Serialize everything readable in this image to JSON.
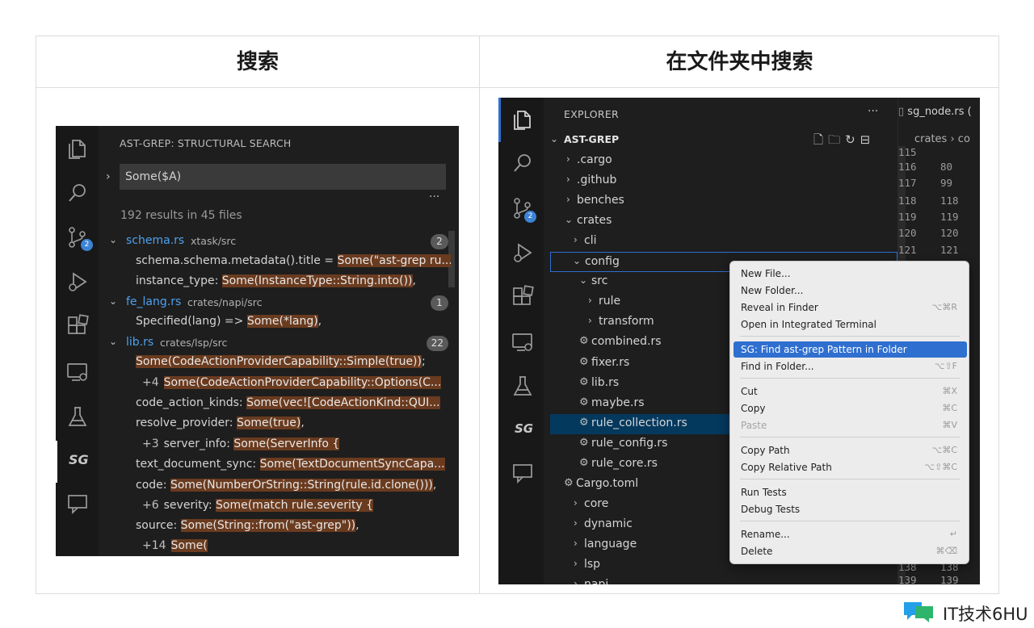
{
  "table": {
    "left_header": "搜索",
    "right_header": "在文件夹中搜索"
  },
  "left_panel": {
    "title": "AST-GREP: STRUCTURAL SEARCH",
    "search_value": "Some($A)",
    "more": "···",
    "results_summary": "192 results in 45 files",
    "scm_badge": "2",
    "sg_logo": "SG",
    "files": [
      {
        "name": "schema.rs",
        "path": "xtask/src",
        "count": "2",
        "matches": [
          {
            "prefix": "",
            "before": "schema.schema.metadata().title = ",
            "hl": "Some(\"ast-grep ru...",
            "after": ""
          },
          {
            "prefix": "",
            "before": "instance_type: ",
            "hl": "Some(InstanceType::String.into())",
            "after": ","
          }
        ]
      },
      {
        "name": "fe_lang.rs",
        "path": "crates/napi/src",
        "count": "1",
        "matches": [
          {
            "prefix": "",
            "before": "Specified(lang) => ",
            "hl": "Some(*lang)",
            "after": ","
          }
        ]
      },
      {
        "name": "lib.rs",
        "path": "crates/lsp/src",
        "count": "22",
        "matches": [
          {
            "prefix": "",
            "before": "",
            "hl": "Some(CodeActionProviderCapability::Simple(true))",
            "after": ";"
          },
          {
            "prefix": "+4",
            "before": "",
            "hl": "Some(CodeActionProviderCapability::Options(C...",
            "after": ""
          },
          {
            "prefix": "",
            "before": "code_action_kinds: ",
            "hl": "Some(vec![CodeActionKind::QUI...",
            "after": ""
          },
          {
            "prefix": "",
            "before": "resolve_provider: ",
            "hl": "Some(true)",
            "after": ","
          },
          {
            "prefix": "+3",
            "before": "server_info: ",
            "hl": "Some(ServerInfo {",
            "after": ""
          },
          {
            "prefix": "",
            "before": "text_document_sync: ",
            "hl": "Some(TextDocumentSyncCapa...",
            "after": ""
          },
          {
            "prefix": "",
            "before": "code: ",
            "hl": "Some(NumberOrString::String(rule.id.clone()))",
            "after": ","
          },
          {
            "prefix": "+6",
            "before": "severity: ",
            "hl": "Some(match rule.severity {",
            "after": ""
          },
          {
            "prefix": "",
            "before": "source: ",
            "hl": "Some(String::from(\"ast-grep\"))",
            "after": ","
          },
          {
            "prefix": "+14",
            "before": "",
            "hl": "Some(",
            "after": ""
          }
        ]
      }
    ]
  },
  "right_panel": {
    "explorer_title": "EXPLORER",
    "more": "···",
    "root": "AST-GREP",
    "scm_badge": "2",
    "sg_logo": "SG",
    "tree": [
      {
        "label": ".cargo"
      },
      {
        "label": ".github"
      },
      {
        "label": "benches"
      },
      {
        "label": "crates"
      },
      {
        "label": "cli"
      },
      {
        "label": "config"
      },
      {
        "label": "src"
      },
      {
        "label": "rule"
      },
      {
        "label": "transform"
      },
      {
        "label": "combined.rs"
      },
      {
        "label": "fixer.rs"
      },
      {
        "label": "lib.rs"
      },
      {
        "label": "maybe.rs"
      },
      {
        "label": "rule_collection.rs"
      },
      {
        "label": "rule_config.rs"
      },
      {
        "label": "rule_core.rs"
      },
      {
        "label": "Cargo.toml"
      },
      {
        "label": "core"
      },
      {
        "label": "dynamic"
      },
      {
        "label": "language"
      },
      {
        "label": "lsp"
      },
      {
        "label": "napi"
      }
    ],
    "editor": {
      "tab": "sg_node.rs (",
      "breadcrumb_1": "crates",
      "breadcrumb_2": "co",
      "line_pairs": [
        [
          "115",
          ""
        ],
        [
          "116",
          "80"
        ],
        [
          "117",
          "99"
        ],
        [
          "118",
          "118"
        ],
        [
          "119",
          "119"
        ],
        [
          "120",
          "120"
        ],
        [
          "121",
          "121"
        ],
        [
          "138",
          "138"
        ],
        [
          "139",
          "139"
        ]
      ]
    }
  },
  "context_menu": {
    "items": [
      {
        "label": "New File...",
        "shortcut": ""
      },
      {
        "label": "New Folder...",
        "shortcut": ""
      },
      {
        "label": "Reveal in Finder",
        "shortcut": "⌥⌘R"
      },
      {
        "label": "Open in Integrated Terminal",
        "shortcut": ""
      },
      {
        "label": "SG: Find ast-grep Pattern in Folder",
        "shortcut": ""
      },
      {
        "label": "Find in Folder...",
        "shortcut": "⌥⇧F"
      },
      {
        "label": "Cut",
        "shortcut": "⌘X"
      },
      {
        "label": "Copy",
        "shortcut": "⌘C"
      },
      {
        "label": "Paste",
        "shortcut": "⌘V"
      },
      {
        "label": "Copy Path",
        "shortcut": "⌥⌘C"
      },
      {
        "label": "Copy Relative Path",
        "shortcut": "⌥⇧⌘C"
      },
      {
        "label": "Run Tests",
        "shortcut": ""
      },
      {
        "label": "Debug Tests",
        "shortcut": ""
      },
      {
        "label": "Rename...",
        "shortcut": "↵"
      },
      {
        "label": "Delete",
        "shortcut": "⌘⌫"
      }
    ]
  },
  "watermark": {
    "text": "IT技术6HU"
  },
  "colors": {
    "panel_bg": "#1e1e1e",
    "activity_bg": "#181818",
    "match_highlight": "#6a3b1f",
    "link_blue": "#4ea1ef",
    "accent_blue": "#2f6fd0"
  }
}
